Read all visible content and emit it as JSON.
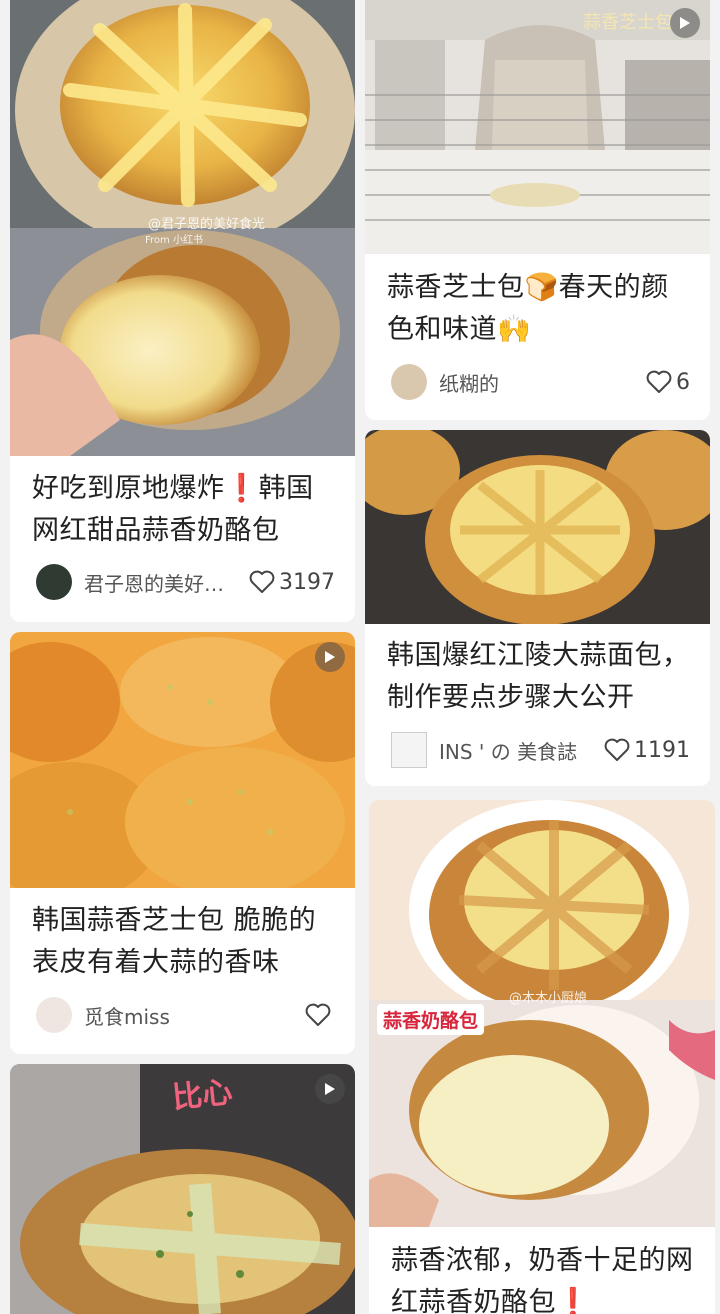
{
  "cards": [
    {
      "title": "好吃到原地爆炸❗韩国网红甜品蒜香奶酪包",
      "author": "君子恩的美好食光",
      "likes": "3197",
      "watermark": "@君子恩的美好食光",
      "watermark_sub": "From 小红书"
    },
    {
      "title": "蒜香芝士包🍞春天的颜色和味道🙌",
      "author": "纸糊的",
      "likes": "6",
      "overlay": "蒜香芝士包"
    },
    {
      "title": "韩国爆红江陵大蒜面包，制作要点步骤大公开",
      "author": "INS ' の 美食誌",
      "likes": "1191"
    },
    {
      "title": "韩国蒜香芝士包 脆脆的表皮有着大蒜的香味",
      "author": "觅食miss",
      "likes": ""
    },
    {
      "title": "蒜香浓郁，奶香十足的网红蒜香奶酪包❗",
      "author": "",
      "likes": "",
      "badge": "蒜香奶酪包",
      "watermark": "@木木小厨娘"
    },
    {
      "title": "",
      "author": "",
      "likes": "",
      "sticker": "比心"
    }
  ],
  "colors": {
    "background": "#f2f2f2",
    "card": "#ffffff",
    "text": "#222222",
    "accent": "#d8263c"
  },
  "icons": {
    "like": "heart-outline-icon",
    "video": "play-icon"
  }
}
